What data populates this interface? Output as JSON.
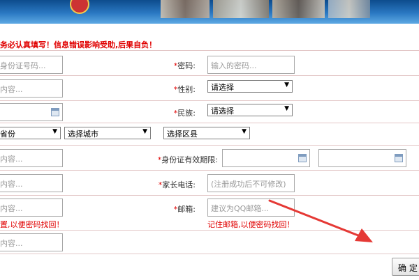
{
  "notice": "务必认真填写！信息错误影响受助,后果自负！",
  "left_inputs": [
    {
      "placeholder": "身份证号码..."
    },
    {
      "placeholder": "内容..."
    },
    {
      "placeholder": ""
    },
    {
      "placeholder": "内容..."
    },
    {
      "placeholder": "内容..."
    },
    {
      "placeholder": "内容..."
    },
    {
      "placeholder": "内容..."
    }
  ],
  "left_hint": "置,以便密码找回！",
  "right_fields": {
    "password": {
      "label": "密码:",
      "placeholder": "输入的密码..."
    },
    "gender": {
      "label": "性别:",
      "value": "请选择"
    },
    "ethnicity": {
      "label": "民族:",
      "value": "请选择"
    },
    "id_validity": {
      "label": "身份证有效期限:",
      "start": "",
      "end": ""
    },
    "parent_phone": {
      "label": "家长电话:",
      "placeholder": "(注册成功后不可修改)"
    },
    "email": {
      "label": "邮箱:",
      "placeholder": "建议为QQ邮箱...",
      "hint": "记住邮箱,以便密码找回！"
    }
  },
  "region": {
    "province": "省份",
    "city": "选择城市",
    "district": "选择区县"
  },
  "submit_label": "确 定",
  "icons": {
    "select_arrow": "▼",
    "required_mark": "*"
  }
}
